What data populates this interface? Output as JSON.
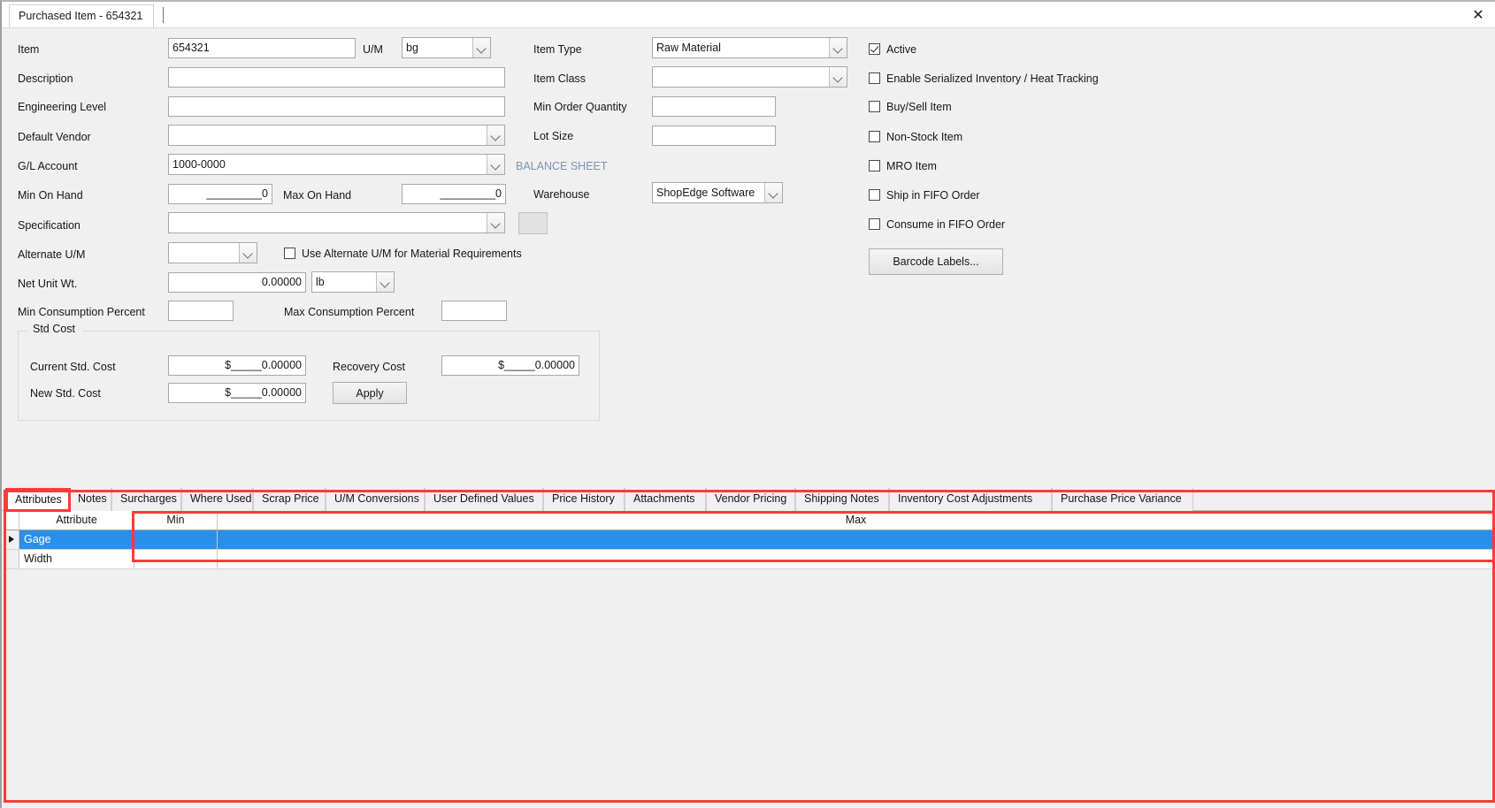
{
  "window": {
    "tab_title": "Purchased Item - 654321",
    "close_icon": "close-icon"
  },
  "form": {
    "left_column": {
      "item_label": "Item",
      "item_value": "654321",
      "um_label": "U/M",
      "um_value": "bg",
      "description_label": "Description",
      "description_value": "",
      "engineering_level_label": "Engineering Level",
      "engineering_level_value": "",
      "default_vendor_label": "Default Vendor",
      "default_vendor_value": "",
      "gl_account_label": "G/L Account",
      "gl_account_value": "1000-0000",
      "min_on_hand_label": "Min On Hand",
      "min_on_hand_value": "_________0",
      "max_on_hand_label": "Max On Hand",
      "max_on_hand_value": "_________0",
      "specification_label": "Specification",
      "specification_value": "",
      "alternate_um_label": "Alternate U/M",
      "alternate_um_value": "",
      "use_alternate_um_label": "Use Alternate U/M for Material Requirements",
      "use_alternate_um_checked": false,
      "net_unit_wt_label": "Net Unit Wt.",
      "net_unit_wt_value": "0.00000",
      "net_unit_wt_uom": "lb",
      "min_consumption_label": "Min Consumption Percent",
      "min_consumption_value": "",
      "max_consumption_label": "Max Consumption Percent",
      "max_consumption_value": ""
    },
    "middle_column": {
      "item_type_label": "Item Type",
      "item_type_value": "Raw Material",
      "item_class_label": "Item Class",
      "item_class_value": "",
      "min_order_qty_label": "Min Order Quantity",
      "min_order_qty_value": "",
      "lot_size_label": "Lot Size",
      "lot_size_value": "",
      "balance_sheet_label": "BALANCE SHEET",
      "warehouse_label": "Warehouse",
      "warehouse_value": "ShopEdge Software"
    },
    "right_column": {
      "checkboxes": [
        {
          "label": "Active",
          "checked": true
        },
        {
          "label": "Enable Serialized Inventory / Heat Tracking",
          "checked": false
        },
        {
          "label": "Buy/Sell Item",
          "checked": false
        },
        {
          "label": "Non-Stock Item",
          "checked": false
        },
        {
          "label": "MRO Item",
          "checked": false
        },
        {
          "label": "Ship in FIFO Order",
          "checked": false
        },
        {
          "label": "Consume in FIFO Order",
          "checked": false
        }
      ],
      "barcode_button": "Barcode Labels..."
    },
    "std_cost_group": {
      "title": "Std Cost",
      "current_std_cost_label": "Current Std. Cost",
      "current_std_cost_value": "$_____0.00000",
      "recovery_cost_label": "Recovery Cost",
      "recovery_cost_value": "$_____0.00000",
      "new_std_cost_label": "New Std. Cost",
      "new_std_cost_value": "$_____0.00000",
      "apply_button": "Apply"
    }
  },
  "tabs": {
    "active_index": 0,
    "items": [
      "Attributes",
      "Notes",
      "Surcharges",
      "Where Used",
      "Scrap Price",
      "U/M Conversions",
      "User Defined Values",
      "Price History",
      "Attachments",
      "Vendor Pricing",
      "Shipping Notes",
      "Inventory Cost Adjustments",
      "Purchase Price Variance"
    ]
  },
  "grid": {
    "columns": [
      "Attribute",
      "Min",
      "Max"
    ],
    "rows": [
      {
        "attribute": "Gage",
        "min": "",
        "max": "",
        "selected": true
      },
      {
        "attribute": "Width",
        "min": "",
        "max": "",
        "selected": false
      }
    ]
  },
  "colors": {
    "selection": "#2a8fe8",
    "annotation": "#fb3b3b",
    "balance_sheet_text": "#7a93ad",
    "window_bg": "#f0f0f0"
  }
}
